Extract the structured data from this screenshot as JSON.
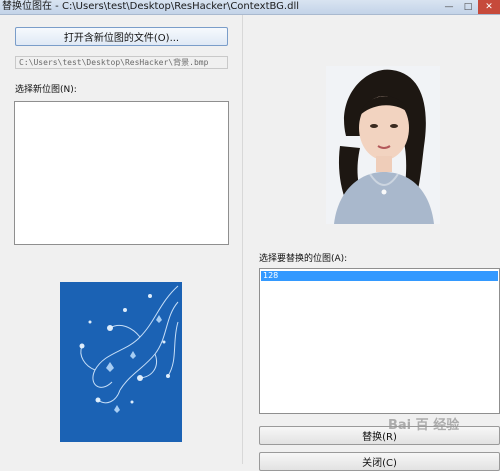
{
  "window": {
    "title": "替换位图在 - C:\\Users\\test\\Desktop\\ResHacker\\ContextBG.dll",
    "buttons": {
      "minimize": "—",
      "maximize": "□",
      "close": "✕"
    }
  },
  "left": {
    "open_button": "打开含新位图的文件(O)...",
    "path_value": "C:\\Users\\test\\Desktop\\ResHacker\\背景.bmp",
    "new_bitmap_label": "选择新位图(N):"
  },
  "right": {
    "select_bitmap_label": "选择要替换的位图(A):",
    "list_items": [
      "128"
    ],
    "replace_button": "替换(R)",
    "close_button": "关闭(C)"
  },
  "watermark": "Bai 百 经验",
  "colors": {
    "preview_blue": "#1b62b4",
    "selection_blue": "#3399ff"
  }
}
